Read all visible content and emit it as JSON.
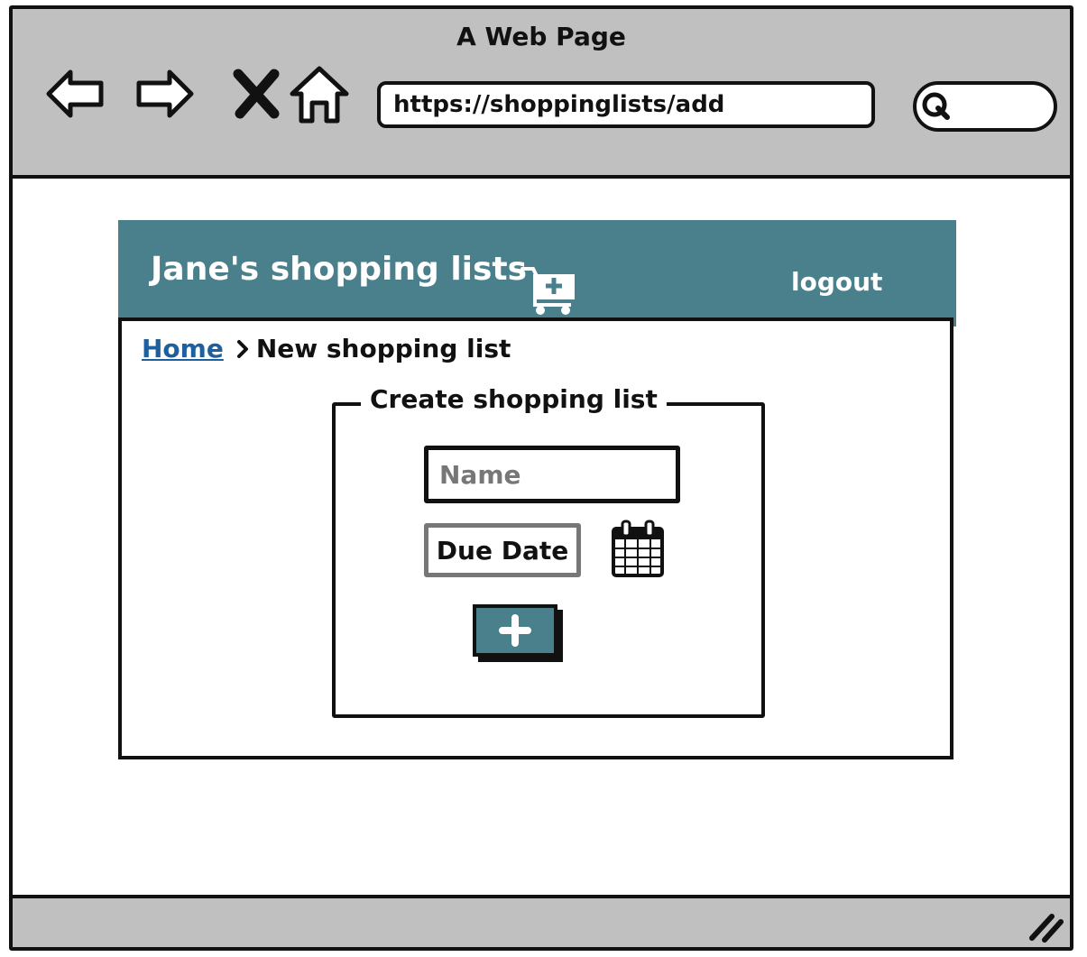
{
  "browser": {
    "title": "A Web Page",
    "url": "https://shoppinglists/add",
    "icons": [
      "back-arrow-icon",
      "forward-arrow-icon",
      "close-icon",
      "home-icon",
      "search-icon",
      "resize-grip-icon"
    ]
  },
  "header": {
    "title": "Jane's shopping lists",
    "logout_label": "logout",
    "icon": "cart-add-icon"
  },
  "breadcrumb": {
    "home": "Home",
    "current": "New shopping list"
  },
  "form": {
    "legend": "Create shopping list",
    "name_placeholder": "Name",
    "name_value": "",
    "due_date_label": "Due Date",
    "calendar_icon": "calendar-icon",
    "add_icon": "plus-icon"
  },
  "colors": {
    "accent": "#4a7f8c",
    "chrome": "#c0c0c0",
    "link": "#1e5f9e",
    "border": "#111111"
  }
}
